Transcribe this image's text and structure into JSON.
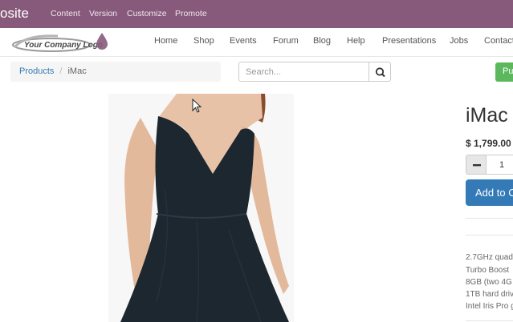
{
  "admin_bar": {
    "brand": "osite",
    "menu": [
      "Content",
      "Version",
      "Customize",
      "Promote"
    ]
  },
  "navbar": {
    "logo_text": "Your Company Logo",
    "items": [
      "Home",
      "Shop",
      "Events",
      "Forum",
      "Blog",
      "Help",
      "Presentations",
      "Jobs",
      "Contact"
    ]
  },
  "breadcrumb": {
    "link": "Products",
    "separator": "/",
    "current": "iMac"
  },
  "search": {
    "placeholder": "Search...",
    "icon": "search-icon"
  },
  "publish_label": "Pu",
  "product": {
    "title": "iMac",
    "price": "$ 1,799.00",
    "quantity": "1",
    "add_to_cart_label": "Add to C",
    "specs": [
      "2.7GHz quad",
      "Turbo Boost",
      "8GB (two 4G",
      "1TB hard driv",
      "Intel Iris Pro g"
    ]
  },
  "colors": {
    "admin_bar": "#875a7b",
    "primary": "#337ab7",
    "publish": "#5cb85c"
  }
}
